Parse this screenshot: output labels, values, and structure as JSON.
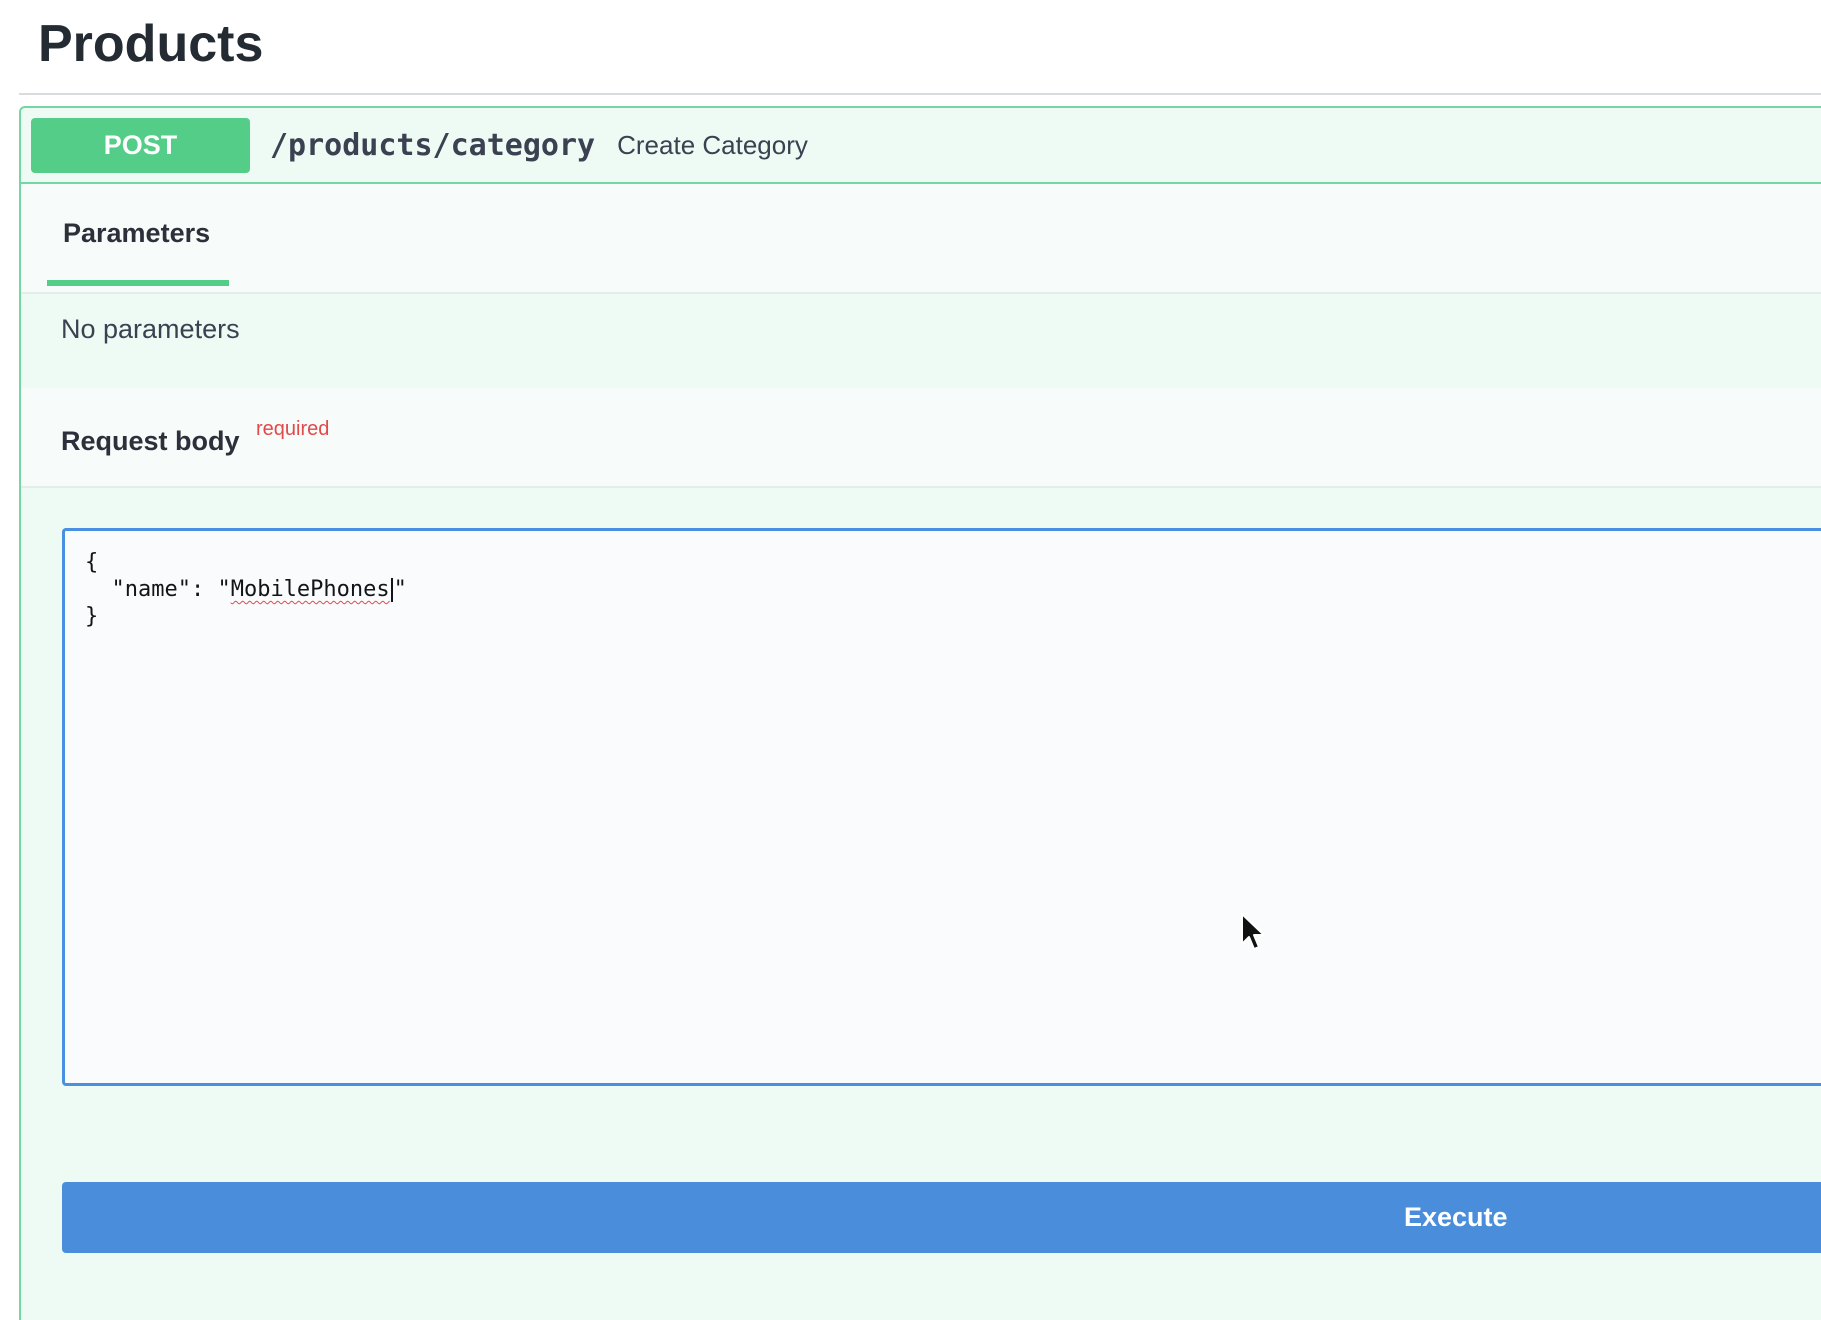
{
  "section": {
    "title": "Products"
  },
  "operation": {
    "method": "POST",
    "path": "/products/category",
    "description": "Create Category",
    "accent_color": "#49cc90"
  },
  "parameters": {
    "tab_label": "Parameters",
    "empty_text": "No parameters"
  },
  "request_body": {
    "title": "Request body",
    "required_label": "required",
    "code_open": "{",
    "code_key_prefix": "  \"name\": \"",
    "code_value": "MobilePhones",
    "code_value_suffix": "\"",
    "code_close": "}"
  },
  "actions": {
    "execute_label": "Execute",
    "execute_color": "#4990e2"
  },
  "icons": {
    "pointer": "mouse-pointer-icon"
  }
}
